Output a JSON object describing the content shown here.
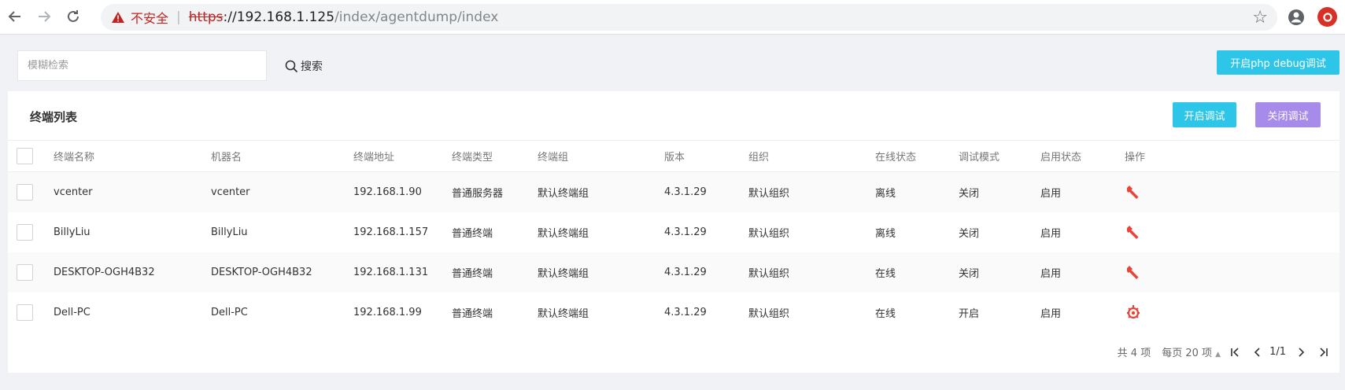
{
  "browser": {
    "insecure_label": "不安全",
    "url_scheme": "https",
    "url_host": "://192.168.1.125",
    "url_path": "/index/agentdump/index"
  },
  "search": {
    "placeholder": "模糊检索",
    "value": "",
    "button_label": "搜索"
  },
  "php_debug_button": "开启php debug调试",
  "card": {
    "title": "终端列表",
    "open_debug_label": "开启调试",
    "close_debug_label": "关闭调试"
  },
  "table": {
    "columns": [
      "终端名称",
      "机器名",
      "终端地址",
      "终端类型",
      "终端组",
      "版本",
      "组织",
      "在线状态",
      "调试模式",
      "启用状态",
      "操作"
    ],
    "rows": [
      {
        "name": "vcenter",
        "machine": "vcenter",
        "ip": "192.168.1.90",
        "type": "普通服务器",
        "group": "默认终端组",
        "version": "4.3.1.29",
        "org": "默认组织",
        "online": "离线",
        "debug": "关闭",
        "enabled": "启用",
        "op_icon": "wrench-icon"
      },
      {
        "name": "BillyLiu",
        "machine": "BillyLiu",
        "ip": "192.168.1.157",
        "type": "普通终端",
        "group": "默认终端组",
        "version": "4.3.1.29",
        "org": "默认组织",
        "online": "离线",
        "debug": "关闭",
        "enabled": "启用",
        "op_icon": "wrench-icon"
      },
      {
        "name": "DESKTOP-OGH4B32",
        "machine": "DESKTOP-OGH4B32",
        "ip": "192.168.1.131",
        "type": "普通终端",
        "group": "默认终端组",
        "version": "4.3.1.29",
        "org": "默认组织",
        "online": "在线",
        "debug": "关闭",
        "enabled": "启用",
        "op_icon": "wrench-icon"
      },
      {
        "name": "Dell-PC",
        "machine": "Dell-PC",
        "ip": "192.168.1.99",
        "type": "普通终端",
        "group": "默认终端组",
        "version": "4.3.1.29",
        "org": "默认组织",
        "online": "在线",
        "debug": "开启",
        "enabled": "启用",
        "op_icon": "bug-icon"
      }
    ]
  },
  "pager": {
    "total": "共 4 项",
    "per_page": "每页 20 项",
    "page": "1/1"
  },
  "colors": {
    "accent_cyan": "#2dc6e9",
    "accent_purple": "#a78bea",
    "icon_red": "#e8443a"
  }
}
